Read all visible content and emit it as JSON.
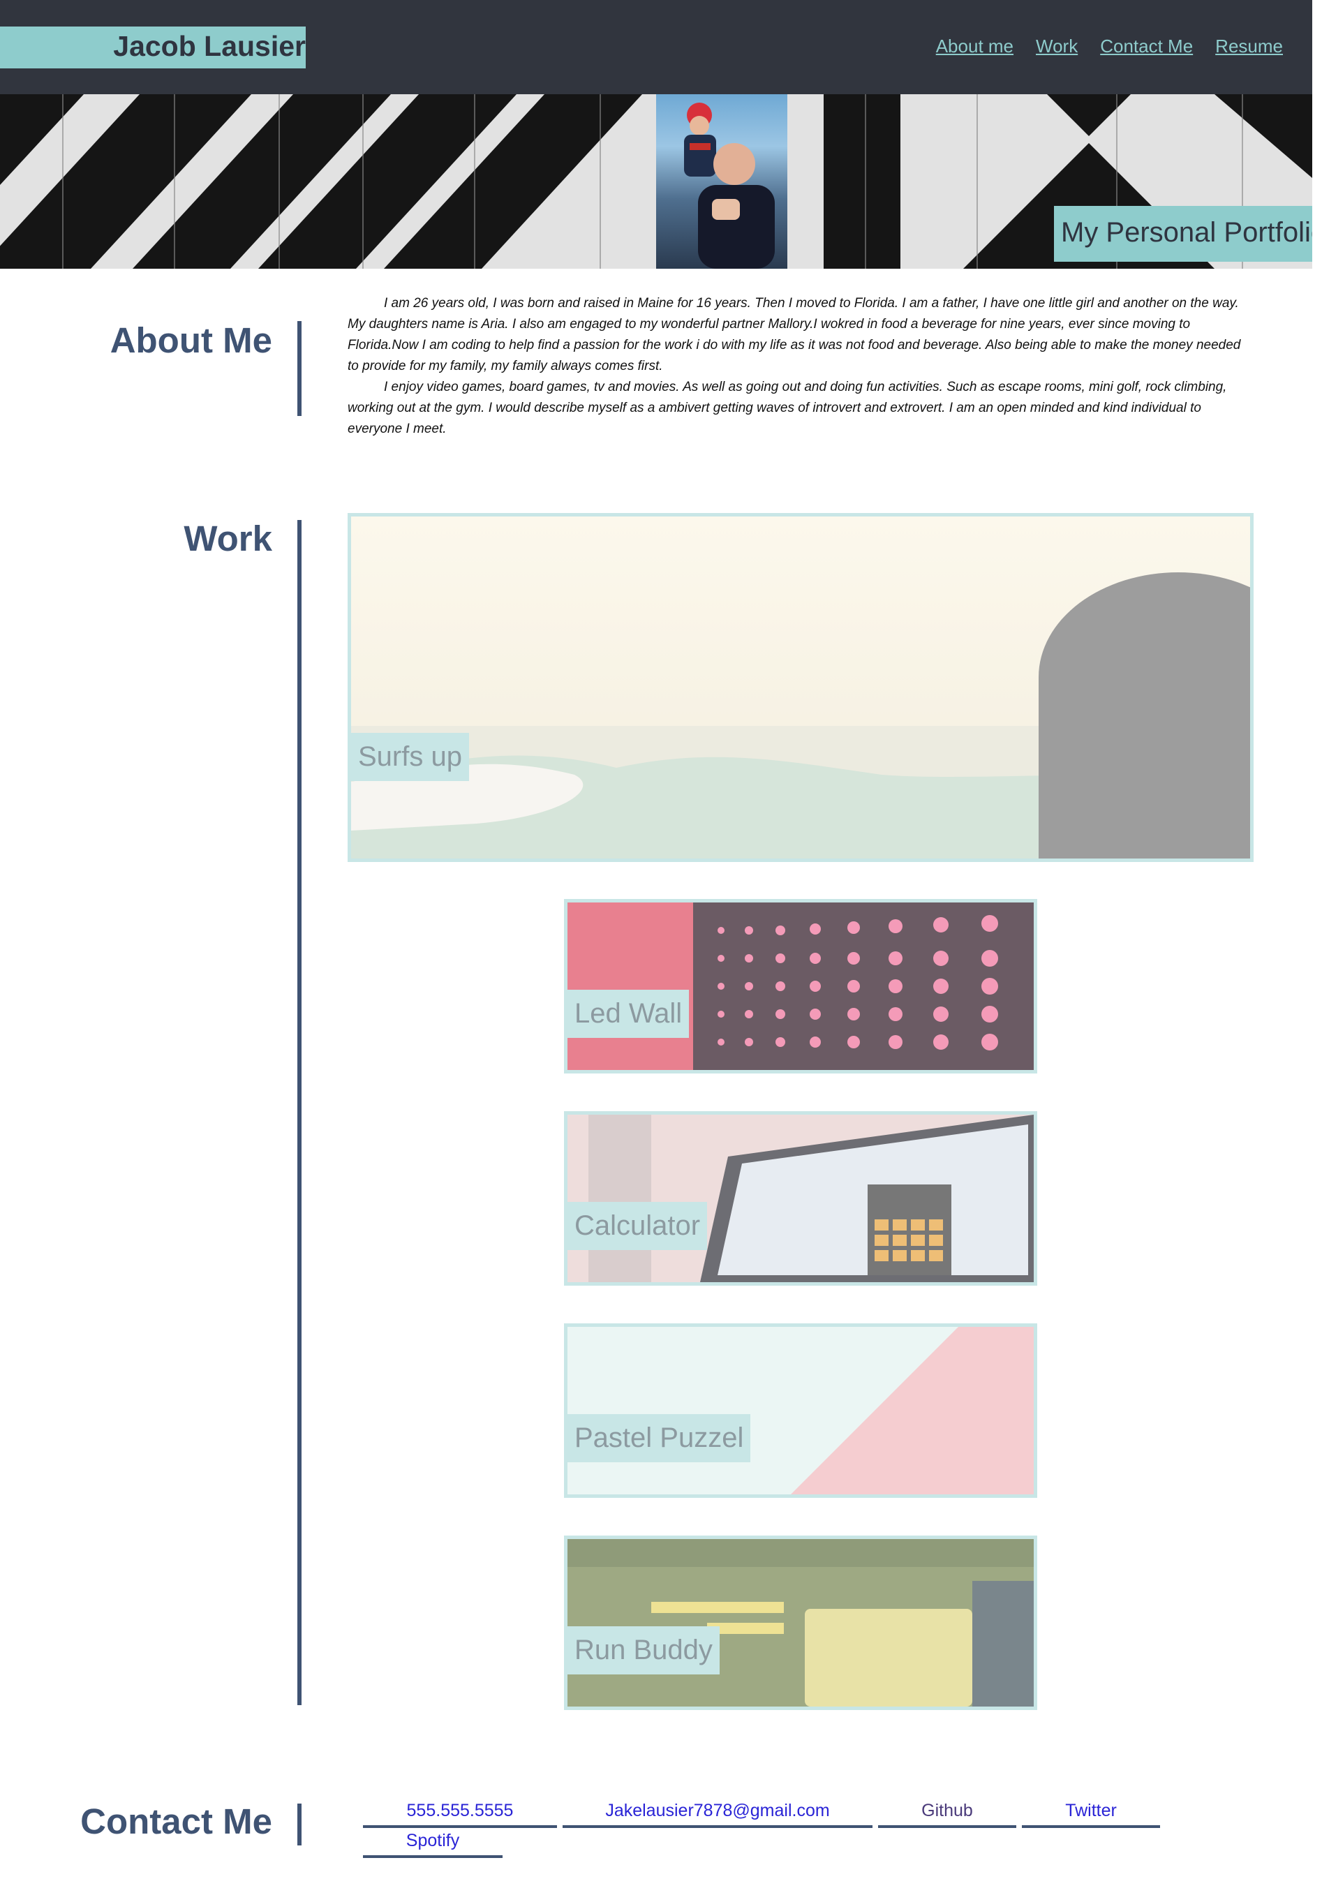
{
  "header": {
    "name": "Jacob Lausier",
    "nav": [
      "About me",
      "Work",
      "Contact Me",
      "Resume"
    ]
  },
  "hero": {
    "title": "My Personal Portfolio"
  },
  "about": {
    "heading": "About Me",
    "paragraphs": [
      "I am 26 years old, I was born and raised in Maine for 16 years. Then I moved to Florida. I am a father, I have one little girl and another on the way. My daughters name is Aria. I also am engaged to my wonderful partner Mallory.I wokred in food a beverage for nine years, ever since moving to Florida.Now I am coding to help find a passion for the work i do with my life as it was not food and beverage. Also being able to make the money needed to provide for my family, my family always comes first.",
      "I enjoy video games, board games, tv and movies. As well as going out and doing fun activities. Such as escape rooms, mini golf, rock climbing, working out at the gym. I would describe myself as a ambivert getting waves of introvert and extrovert. I am an open minded and kind individual to everyone I meet."
    ]
  },
  "work": {
    "heading": "Work",
    "projects": [
      {
        "label": "Surfs up"
      },
      {
        "label": "Led Wall"
      },
      {
        "label": "Calculator"
      },
      {
        "label": "Pastel Puzzel"
      },
      {
        "label": "Run Buddy"
      }
    ]
  },
  "contact": {
    "heading": "Contact Me",
    "links": [
      "555.555.5555",
      "Jakelausier7878@gmail.com",
      "Github",
      "Twitter",
      "Spotify"
    ]
  }
}
